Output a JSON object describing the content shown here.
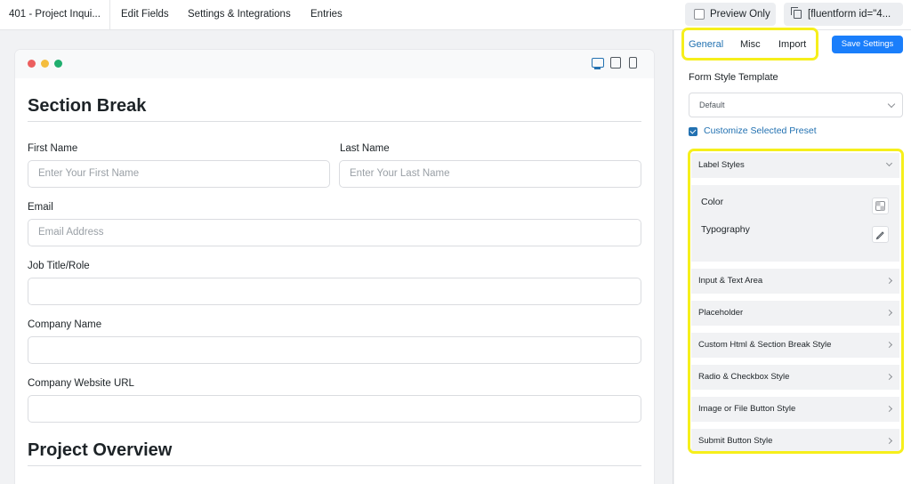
{
  "topbar": {
    "form_title": "401 - Project Inqui...",
    "nav": [
      "Edit Fields",
      "Settings & Integrations",
      "Entries"
    ],
    "preview_label": "Preview Only",
    "shortcode": "[fluentform id=\"4..."
  },
  "preview": {
    "devices": [
      "desktop-icon",
      "tablet-icon",
      "mobile-icon"
    ],
    "sections": [
      "Section Break",
      "Project Overview"
    ],
    "fields": {
      "first_name": {
        "label": "First Name",
        "placeholder": "Enter Your First Name"
      },
      "last_name": {
        "label": "Last Name",
        "placeholder": "Enter Your Last Name"
      },
      "email": {
        "label": "Email",
        "placeholder": "Email Address"
      },
      "job_title": {
        "label": "Job Title/Role",
        "placeholder": ""
      },
      "company": {
        "label": "Company Name",
        "placeholder": ""
      },
      "website": {
        "label": "Company Website URL",
        "placeholder": ""
      }
    }
  },
  "panel": {
    "tabs": [
      "General",
      "Misc",
      "Import"
    ],
    "active_tab": "General",
    "save_label": "Save Settings",
    "template_label": "Form Style Template",
    "template_value": "Default",
    "customize_label": "Customize Selected Preset",
    "customize_checked": true,
    "label_styles": {
      "title": "Label Styles",
      "items": [
        "Color",
        "Typography"
      ]
    },
    "accordions": [
      "Input & Text Area",
      "Placeholder",
      "Custom Html & Section Break Style",
      "Radio & Checkbox Style",
      "Image or File Button Style",
      "Submit Button Style"
    ]
  },
  "colors": {
    "accent": "#1a7efb",
    "highlight": "#f6ef1b",
    "link": "#2271b1"
  }
}
